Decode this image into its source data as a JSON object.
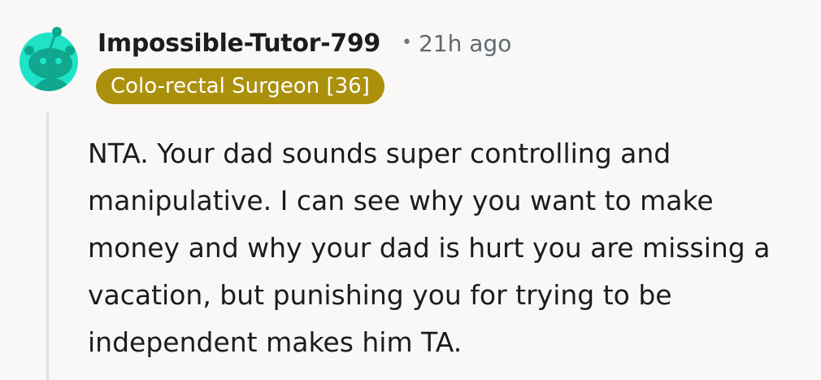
{
  "comment": {
    "avatar_icon": "reddit-snoo-avatar-icon",
    "avatar_color": "#1fe3c7",
    "username": "Impossible-Tutor-799",
    "separator": "•",
    "timestamp": "21h ago",
    "flair": {
      "text": "Colo-rectal Surgeon [36]",
      "background": "#ab900c",
      "text_color": "#ffffff"
    },
    "body": "NTA. Your dad sounds super controlling and manipulative. I can see why you want to make money and why your dad is hurt you are missing a vacation, but punishing you for trying to be independent makes him TA."
  }
}
